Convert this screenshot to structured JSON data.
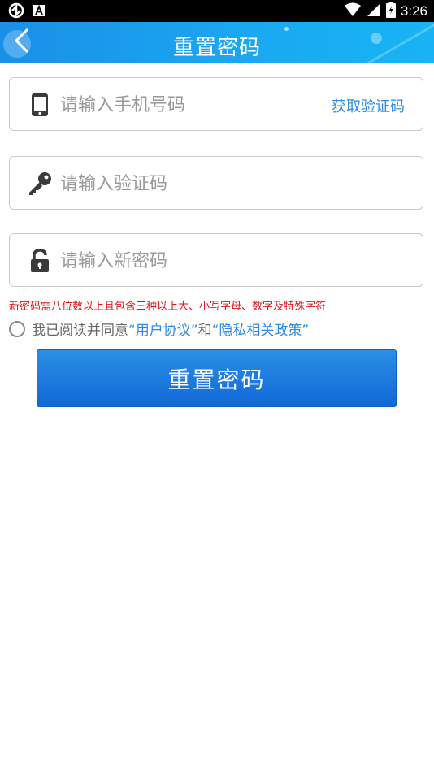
{
  "status_bar": {
    "time": "3:26",
    "icons": [
      "sync-icon",
      "a-icon",
      "wifi-icon",
      "signal-icon",
      "battery-icon"
    ]
  },
  "header": {
    "title": "重置密码",
    "back_icon": "chevron-left-icon",
    "background": "#1a9ff0"
  },
  "form": {
    "phone": {
      "placeholder": "请输入手机号码",
      "value": "",
      "icon": "phone-icon"
    },
    "get_code_label": "获取验证码",
    "code": {
      "placeholder": "请输入验证码",
      "value": "",
      "icon": "key-icon"
    },
    "password": {
      "placeholder": "请输入新密码",
      "value": "",
      "icon": "lock-icon"
    },
    "password_hint": "新密码需八位数以上且包含三种以上大、小写字母、数字及特殊字符"
  },
  "agreement": {
    "prefix": "我已阅读并同意",
    "user_agreement": "“用户协议”",
    "conjunction": "和",
    "privacy_policy": "“隐私相关政策”"
  },
  "submit_label": "重置密码",
  "colors": {
    "accent": "#2a8ae6",
    "button": "#1a76de",
    "hint": "#e01414",
    "border": "#c9c9c9"
  }
}
